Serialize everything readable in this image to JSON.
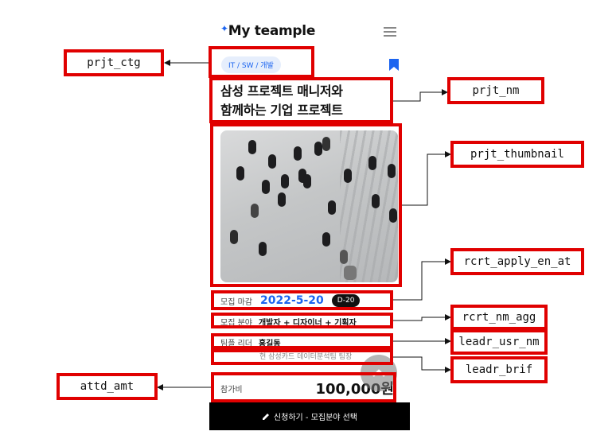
{
  "app": {
    "logo_mark": "✦",
    "logo_text": "My teample"
  },
  "project": {
    "category": "IT / SW / 개발",
    "name_line1": "삼성 프로젝트 매니저와",
    "name_line2": "함께하는 기업 프로젝트",
    "deadline_label": "모집 마감",
    "deadline_date": "2022-5-20",
    "dday": "D-20",
    "fields_label": "모집 분야",
    "fields_value": "개발자 + 디자이너 + 기획자",
    "leader_label": "팀플 리더",
    "leader_name": "홍길동",
    "leader_brief": "현 삼성카드 데이터분석팀 팀장",
    "fee_label": "참가비",
    "fee_value": "100,000원",
    "apply_button": "신청하기 - 모집분야 선택"
  },
  "annotations": {
    "prjt_ctg": "prjt_ctg",
    "prjt_nm": "prjt_nm",
    "prjt_thumbnail": "prjt_thumbnail",
    "rcrt_apply_en_at": "rcrt_apply_en_at",
    "rcrt_nm_agg": "rcrt_nm_agg",
    "leadr_usr_nm": "leadr_usr_nm",
    "leadr_brif": "leadr_brif",
    "attd_amt": "attd_amt"
  },
  "colors": {
    "accent": "#1b64f0",
    "annotation": "#e00000"
  },
  "icons": [
    "menu-icon",
    "bookmark-icon",
    "pencil-icon",
    "chevron-up-icon"
  ]
}
